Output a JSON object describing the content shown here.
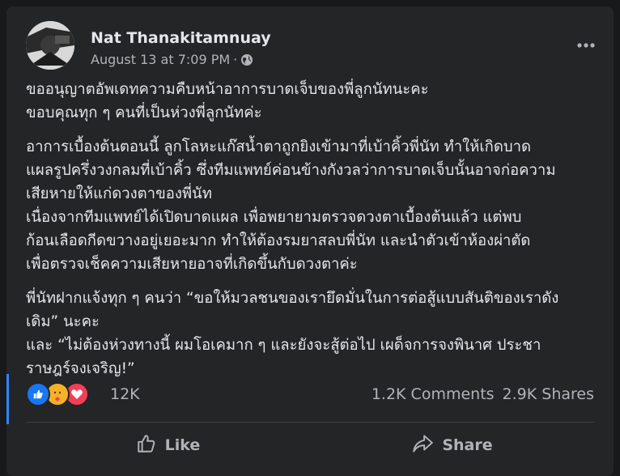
{
  "post": {
    "author": "Nat Thanakitamnuay",
    "timestamp": "August 13 at 7:09 PM",
    "separator": "·",
    "privacy_icon": "globe-icon",
    "more_icon": "more-options-icon",
    "paragraphs": [
      [
        "ขออนุญาตอัพเดทความคืบหน้าอาการบาดเจ็บของพี่ลูกนัทนะคะ",
        "ขอบคุณทุก ๆ คนที่เป็นห่วงพี่ลูกนัทค่ะ"
      ],
      [
        "อาการเบื้องต้นตอนนี้ ลูกโลหะแก๊สน้ำตาถูกยิงเข้ามาที่เบ้าคิ้วพี่นัท ทำให้เกิดบาด",
        "แผลรูปครึ่งวงกลมที่เบ้าคิ้ว ซึ่งทีมแพทย์ค่อนข้างกังวลว่าการบาดเจ็บนั้นอาจก่อความ",
        "เสียหายให้แก่ดวงตาของพี่นัท",
        "เนื่องจากทีมแพทย์ได้เปิดบาดแผล เพื่อพยายามตรวจดวงตาเบื้องต้นแล้ว แต่พบ",
        "ก้อนเลือดกีดขวางอยู่เยอะมาก ทำให้ต้องรมยาสลบพี่นัท และนำตัวเข้าห้องผ่าตัด",
        "เพื่อตรวจเช็คความเสียหายอาจที่เกิดขึ้นกับดวงตาค่ะ"
      ],
      [
        "พี่นัทฝากแจ้งทุก ๆ คนว่า “ขอให้มวลชนของเรายึดมั่นในการต่อสู้แบบสันติของเราดัง",
        "เดิม” นะคะ",
        "และ “ไม่ต้องห่วงทางนี้ ผมโอเคมาก ๆ และยังจะสู้ต่อไป เผด็จการจงพินาศ ประชา",
        "ราษฎร์จงเจริญ!”"
      ]
    ]
  },
  "reactions": {
    "icons": [
      "like-reaction-icon",
      "care-reaction-icon",
      "love-reaction-icon"
    ],
    "count": "12K",
    "comments": "1.2K Comments",
    "shares": "2.9K Shares"
  },
  "actions": {
    "like_label": "Like",
    "share_label": "Share"
  },
  "colors": {
    "background": "#18191a",
    "card": "#242526",
    "primary_text": "#e4e6eb",
    "secondary_text": "#b0b3b8",
    "like_blue": "#1877f2",
    "love_red": "#f33e58",
    "care_yellow": "#f7b125"
  }
}
